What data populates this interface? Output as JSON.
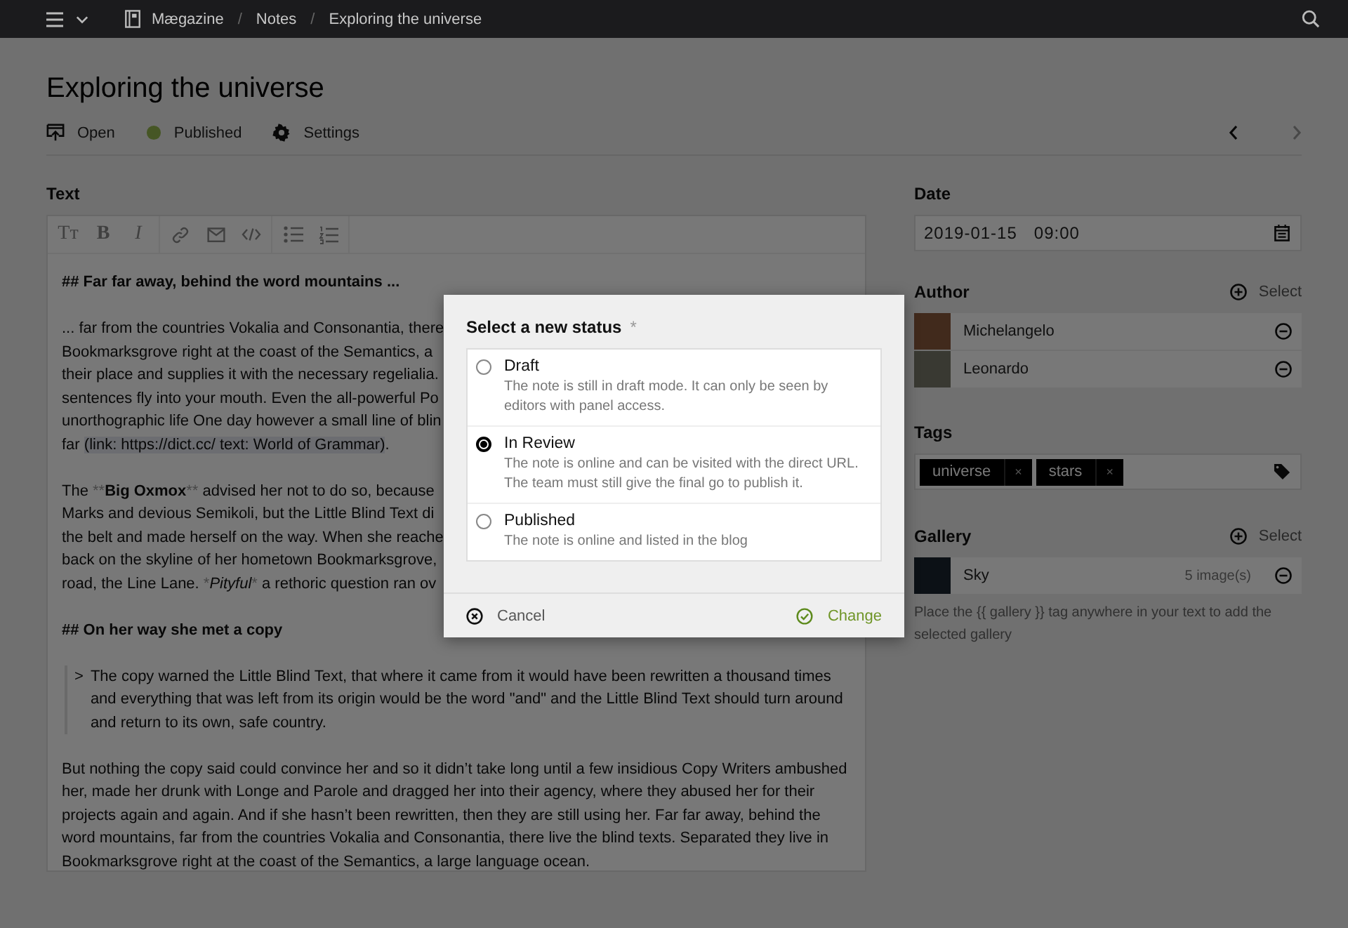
{
  "topbar": {
    "breadcrumbs": [
      "Mægazine",
      "Notes",
      "Exploring the universe"
    ],
    "separator": "/"
  },
  "page": {
    "title": "Exploring the universe",
    "actions": [
      {
        "kind": "open",
        "label": "Open"
      },
      {
        "kind": "status",
        "label": "Published"
      },
      {
        "kind": "settings",
        "label": "Settings"
      }
    ],
    "pager": [
      {
        "kind": "prev",
        "disabled": false
      },
      {
        "kind": "next",
        "disabled": true
      }
    ]
  },
  "editor": {
    "label": "Text",
    "toolbar": [
      [
        {
          "kind": "heading",
          "text": "Tт"
        },
        {
          "kind": "bold",
          "text": "B"
        },
        {
          "kind": "italic",
          "text": "I"
        }
      ],
      [
        {
          "kind": "link"
        },
        {
          "kind": "email"
        },
        {
          "kind": "code"
        }
      ],
      [
        {
          "kind": "bullets"
        },
        {
          "kind": "numbers"
        }
      ]
    ],
    "blocks": [
      {
        "kind": "heading",
        "text": "## Far far away, behind the word mountains ..."
      },
      {
        "kind": "lines",
        "lines": [
          [
            {
              "kind": "plain",
              "text": "... far from the countries Vokalia and Consonantia, there"
            }
          ],
          [
            {
              "kind": "plain",
              "text": "Bookmarksgrove right at the coast of the Semantics, a"
            }
          ],
          [
            {
              "kind": "plain",
              "text": "their place and supplies it with the necessary regelialia."
            }
          ],
          [
            {
              "kind": "plain",
              "text": "sentences fly into your mouth. Even the all-powerful Po"
            }
          ],
          [
            {
              "kind": "plain",
              "text": "unorthographic life One day however a small line of blin"
            }
          ],
          [
            {
              "kind": "plain",
              "text": "far "
            },
            {
              "kind": "highlight",
              "text": "(link: https://dict.cc/ text: World of Grammar)"
            },
            {
              "kind": "plain",
              "text": "."
            }
          ]
        ]
      },
      {
        "kind": "lines",
        "lines": [
          [
            {
              "kind": "plain",
              "text": "The "
            },
            {
              "kind": "mark",
              "text": "**"
            },
            {
              "kind": "bold",
              "text": "Big Oxmox"
            },
            {
              "kind": "mark",
              "text": "**"
            },
            {
              "kind": "plain",
              "text": " advised her not to do so, because"
            }
          ],
          [
            {
              "kind": "plain",
              "text": "Marks and devious Semikoli, but the Little Blind Text di"
            }
          ],
          [
            {
              "kind": "plain",
              "text": "the belt and made herself on the way. When she reache"
            }
          ],
          [
            {
              "kind": "plain",
              "text": "back on the skyline of her hometown Bookmarksgrove,"
            }
          ],
          [
            {
              "kind": "plain",
              "text": "road, the Line Lane. "
            },
            {
              "kind": "mark",
              "text": "*"
            },
            {
              "kind": "italic",
              "text": "Pityful"
            },
            {
              "kind": "mark",
              "text": "*"
            },
            {
              "kind": "plain",
              "text": " a rethoric question ran ov"
            }
          ]
        ]
      },
      {
        "kind": "heading",
        "text": "## On her way she met a copy"
      },
      {
        "kind": "quote",
        "marker": ">",
        "text": "The copy warned the Little Blind Text, that where it came from it would have been rewritten a thousand times and everything that was left from its origin would be the word \"and\" and the Little Blind Text should turn around and return to its own, safe country."
      },
      {
        "kind": "paragraph",
        "text": "But nothing the copy said could convince her and so it didn’t take long until a few insidious Copy Writers ambushed her, made her drunk with Longe and Parole and dragged her into their agency, where they abused her for their projects again and again. And if she hasn’t been rewritten, then they are still using her. Far far away, behind the word mountains, far from the countries Vokalia and Consonantia, there live the blind texts. Separated they live in Bookmarksgrove right at the coast of the Semantics, a large language ocean."
      }
    ]
  },
  "sidebar": {
    "date": {
      "label": "Date",
      "date": "2019-01-15",
      "time": "09:00"
    },
    "author": {
      "label": "Author",
      "action": "Select",
      "items": [
        {
          "name": "Michelangelo"
        },
        {
          "name": "Leonardo"
        }
      ]
    },
    "tags": {
      "label": "Tags",
      "items": [
        {
          "label": "universe",
          "remove": "×"
        },
        {
          "label": "stars",
          "remove": "×"
        }
      ]
    },
    "gallery": {
      "label": "Gallery",
      "action": "Select",
      "items": [
        {
          "name": "Sky",
          "count": "5 image(s)"
        }
      ],
      "help": "Place the {{ gallery }} tag anywhere in your text to add the selected gallery"
    }
  },
  "dialog": {
    "title": "Select a new status",
    "required_mark": "*",
    "options": [
      {
        "label": "Draft",
        "description": "The note is still in draft mode. It can only be seen by editors with panel access.",
        "selected": false
      },
      {
        "label": "In Review",
        "description": "The note is online and can be visited with the direct URL. The team must still give the final go to publish it.",
        "selected": true
      },
      {
        "label": "Published",
        "description": "The note is online and listed in the blog",
        "selected": false
      }
    ],
    "cancel": "Cancel",
    "confirm": "Change"
  }
}
